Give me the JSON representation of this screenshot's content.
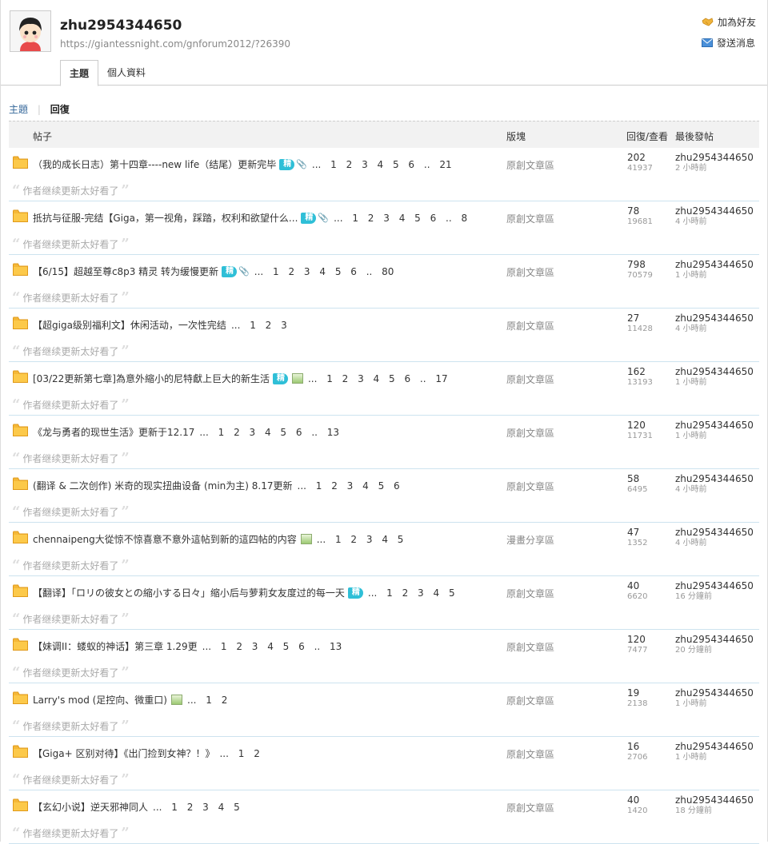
{
  "profile": {
    "username": "zhu2954344650",
    "url": "https://giantessnight.com/gnforum2012/?26390",
    "add_friend": "加為好友",
    "send_message": "發送消息"
  },
  "tabs": [
    {
      "label": "主題",
      "active": true
    },
    {
      "label": "個人資料",
      "active": false
    }
  ],
  "subnav": {
    "topics": "主題",
    "replies": "回復"
  },
  "table_header": {
    "post": "帖子",
    "forum": "版塊",
    "reply_view": "回復/查看",
    "last_post": "最後發帖"
  },
  "rows": [
    {
      "title": "（我的成长日志）第十四章----new life（结尾）更新完毕",
      "badge": "精",
      "clip": true,
      "img": false,
      "pages": "... 1 2 3 4 5 6 .. 21",
      "forum": "原創文章區",
      "replies": "202",
      "views": "41937",
      "last_user": "zhu2954344650",
      "last_time": "2 小時前",
      "quote": "作者继续更新太好看了"
    },
    {
      "title": "抵抗与征服-完结【Giga，第一视角，踩踏，权利和欲望什么...",
      "badge": "精",
      "clip": true,
      "img": false,
      "pages": "... 1 2 3 4 5 6 .. 8",
      "forum": "原創文章區",
      "replies": "78",
      "views": "19681",
      "last_user": "zhu2954344650",
      "last_time": "4 小時前",
      "quote": "作者继续更新太好看了"
    },
    {
      "title": "【6/15】超越至尊c8p3 精灵 转为缓慢更新",
      "badge": "精",
      "clip": true,
      "img": false,
      "pages": "... 1 2 3 4 5 6 .. 80",
      "forum": "原創文章區",
      "replies": "798",
      "views": "70579",
      "last_user": "zhu2954344650",
      "last_time": "1 小時前",
      "quote": "作者继续更新太好看了"
    },
    {
      "title": "【超giga级别福利文】休闲活动，一次性完结",
      "badge": "",
      "clip": false,
      "img": false,
      "pages": "... 1 2 3",
      "forum": "原創文章區",
      "replies": "27",
      "views": "11428",
      "last_user": "zhu2954344650",
      "last_time": "4 小時前",
      "quote": "作者继续更新太好看了"
    },
    {
      "title": "[03/22更新第七章]為意外縮小的尼特獻上巨大的新生活",
      "badge": "精",
      "clip": false,
      "img": true,
      "pages": "... 1 2 3 4 5 6 .. 17",
      "forum": "原創文章區",
      "replies": "162",
      "views": "13193",
      "last_user": "zhu2954344650",
      "last_time": "1 小時前",
      "quote": "作者继续更新太好看了"
    },
    {
      "title": "《龙与勇者的现世生活》更新于12.17",
      "badge": "",
      "clip": false,
      "img": false,
      "pages": "... 1 2 3 4 5 6 .. 13",
      "forum": "原創文章區",
      "replies": "120",
      "views": "11731",
      "last_user": "zhu2954344650",
      "last_time": "1 小時前",
      "quote": "作者继续更新太好看了"
    },
    {
      "title": "(翻译 & 二次创作) 米奇的现实扭曲设备 (min为主) 8.17更新",
      "badge": "",
      "clip": false,
      "img": false,
      "pages": "... 1 2 3 4 5 6",
      "forum": "原創文章區",
      "replies": "58",
      "views": "6495",
      "last_user": "zhu2954344650",
      "last_time": "4 小時前",
      "quote": "作者继续更新太好看了"
    },
    {
      "title": "chennaipeng大從惊不惊喜意不意外這帖到新的這四帖的内容",
      "badge": "",
      "clip": false,
      "img": true,
      "pages": "... 1 2 3 4 5",
      "forum": "漫畫分享區",
      "replies": "47",
      "views": "1352",
      "last_user": "zhu2954344650",
      "last_time": "4 小時前",
      "quote": "作者继续更新太好看了"
    },
    {
      "title": "【翻译】「ロリの彼女との縮小する日々」缩小后与萝莉女友度过的每一天",
      "badge": "精",
      "clip": false,
      "img": false,
      "pages": "... 1 2 3 4 5",
      "forum": "原創文章區",
      "replies": "40",
      "views": "6620",
      "last_user": "zhu2954344650",
      "last_time": "16 分鐘前",
      "quote": "作者继续更新太好看了"
    },
    {
      "title": "【妹调II：蝼蚁的神话】第三章 1.29更",
      "badge": "",
      "clip": false,
      "img": false,
      "pages": "... 1 2 3 4 5 6 .. 13",
      "forum": "原創文章區",
      "replies": "120",
      "views": "7477",
      "last_user": "zhu2954344650",
      "last_time": "20 分鐘前",
      "quote": "作者继续更新太好看了"
    },
    {
      "title": "Larry's mod (足控向、微重口)",
      "badge": "",
      "clip": false,
      "img": true,
      "pages": "... 1 2",
      "forum": "原創文章區",
      "replies": "19",
      "views": "2138",
      "last_user": "zhu2954344650",
      "last_time": "1 小時前",
      "quote": "作者继续更新太好看了"
    },
    {
      "title": "【Giga+ 区别对待】《出门捡到女神？！》",
      "badge": "",
      "clip": false,
      "img": false,
      "pages": "... 1 2",
      "forum": "原創文章區",
      "replies": "16",
      "views": "2706",
      "last_user": "zhu2954344650",
      "last_time": "1 小時前",
      "quote": "作者继续更新太好看了"
    },
    {
      "title": "【玄幻小说】逆天邪神同人",
      "badge": "",
      "clip": false,
      "img": false,
      "pages": "... 1 2 3 4 5",
      "forum": "原創文章區",
      "replies": "40",
      "views": "1420",
      "last_user": "zhu2954344650",
      "last_time": "18 分鐘前",
      "quote": "作者继续更新太好看了"
    }
  ]
}
